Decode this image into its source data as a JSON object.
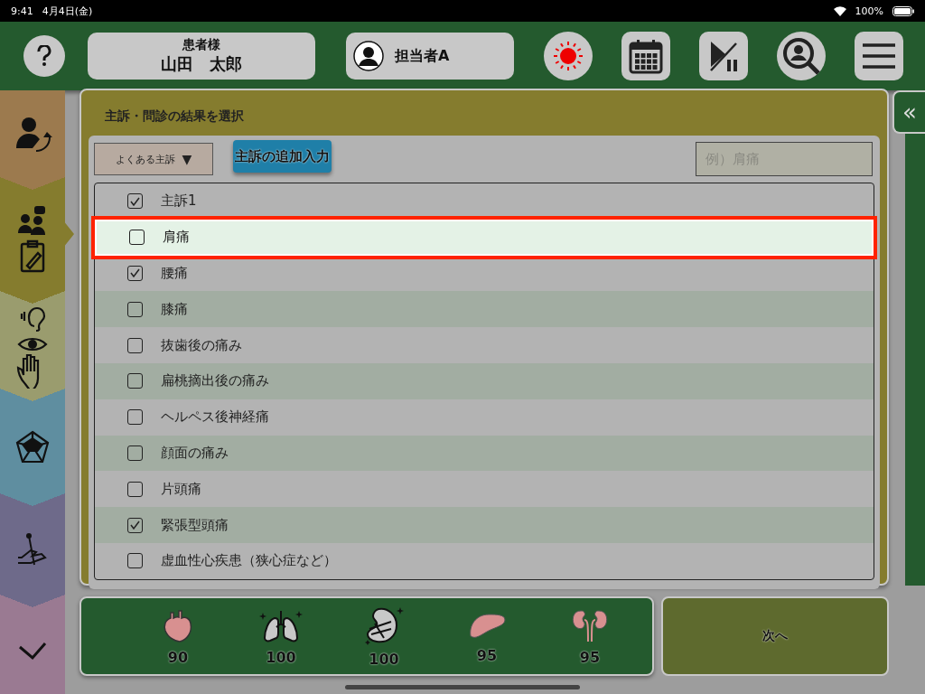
{
  "status_bar": {
    "time": "9:41",
    "date": "4月4日(金)",
    "battery": "100%"
  },
  "header": {
    "patient_label": "患者様",
    "patient_name": "山田　太郎",
    "staff": "担当者A"
  },
  "sidebar": {
    "items": [
      {
        "kind": "patient",
        "selected": false,
        "color": "#9c7a4e"
      },
      {
        "kind": "interview",
        "selected": true,
        "color": "#857c2e"
      },
      {
        "kind": "senses",
        "selected": false,
        "color": "#9a9c6e"
      },
      {
        "kind": "chart",
        "selected": false,
        "color": "#5f8ea0"
      },
      {
        "kind": "acupuncture",
        "selected": false,
        "color": "#6e6a8a"
      },
      {
        "kind": "done",
        "selected": false,
        "color": "#9a7a92"
      }
    ]
  },
  "panel": {
    "title": "主訴・問診の結果を選択",
    "dropdown": "よくある主訴",
    "dropdown_arrow": "▼",
    "add_button": "主訴の追加入力",
    "search": {
      "placeholder": "例）肩痛"
    },
    "items": [
      {
        "label": "主訴1",
        "checked": true,
        "selected": false
      },
      {
        "label": "肩痛",
        "checked": false,
        "selected": true
      },
      {
        "label": "腰痛",
        "checked": true,
        "selected": false
      },
      {
        "label": "膝痛",
        "checked": false,
        "selected": false
      },
      {
        "label": "抜歯後の痛み",
        "checked": false,
        "selected": false
      },
      {
        "label": "扁桃摘出後の痛み",
        "checked": false,
        "selected": false
      },
      {
        "label": "ヘルペス後神経痛",
        "checked": false,
        "selected": false
      },
      {
        "label": "顔面の痛み",
        "checked": false,
        "selected": false
      },
      {
        "label": "片頭痛",
        "checked": false,
        "selected": false
      },
      {
        "label": "緊張型頭痛",
        "checked": true,
        "selected": false
      },
      {
        "label": "虚血性心疾患（狭心症など）",
        "checked": false,
        "selected": false
      }
    ]
  },
  "collapse_button": "«",
  "organs": [
    {
      "kind": "heart",
      "score": "90",
      "color": "#d89090"
    },
    {
      "kind": "lungs",
      "score": "100",
      "color": "#c8c8c8"
    },
    {
      "kind": "stomach",
      "score": "100",
      "color": "#c8c8c8"
    },
    {
      "kind": "liver",
      "score": "95",
      "color": "#d89090"
    },
    {
      "kind": "kidneys",
      "score": "95",
      "color": "#d89090"
    }
  ],
  "next_button": "次へ"
}
